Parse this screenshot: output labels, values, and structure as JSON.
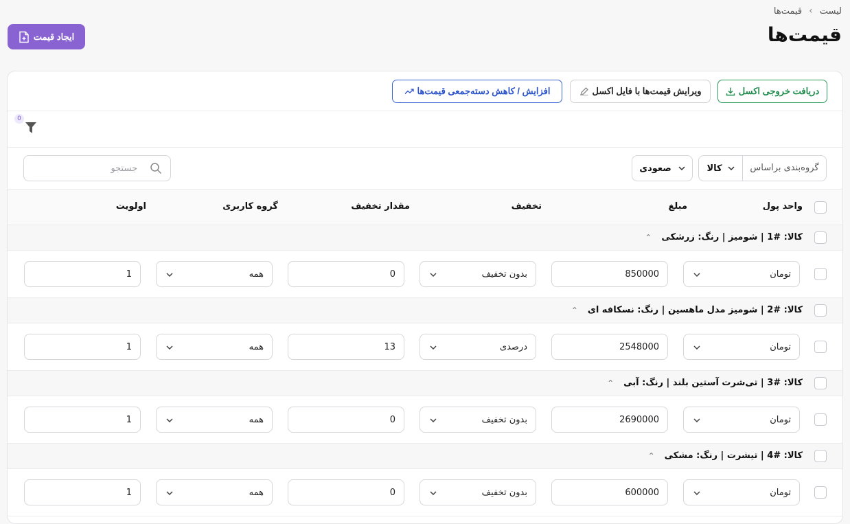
{
  "breadcrumb": {
    "parent": "قیمت‌ها",
    "current": "لیست"
  },
  "page": {
    "title": "قیمت‌ها",
    "create_label": "ایجاد قیمت"
  },
  "toolbar": {
    "export_label": "دریافت خروجی اکسل",
    "edit_excel_label": "ویرایش قیمت‌ها با فایل اکسل",
    "bulk_label": "افزایش / کاهش دسته‌جمعی قیمت‌ها"
  },
  "filter": {
    "count": "0"
  },
  "controls": {
    "group_by_label": "گروه‌بندی براساس",
    "group_by_value": "کالا",
    "sort_value": "صعودی",
    "search_placeholder": "جستجو"
  },
  "columns": {
    "currency": "واحد پول",
    "amount": "مبلغ",
    "discount": "تخفیف",
    "discount_amount": "مقدار تخفیف",
    "user_group": "گروه کاربری",
    "priority": "اولویت"
  },
  "groups": [
    {
      "title": "کالا: #1 | شومیز | رنگ: زرشکی",
      "currency": "تومان",
      "amount": "850000",
      "discount": "بدون تخفیف",
      "discount_amount": "0",
      "user_group": "همه",
      "priority": "1"
    },
    {
      "title": "کالا: #2 | شومیز مدل ماهسین | رنگ: نسکافه ای",
      "currency": "تومان",
      "amount": "2548000",
      "discount": "درصدی",
      "discount_amount": "13",
      "user_group": "همه",
      "priority": "1"
    },
    {
      "title": "کالا: #3 | تی‌شرت آستین بلند | رنگ: آبی",
      "currency": "تومان",
      "amount": "2690000",
      "discount": "بدون تخفیف",
      "discount_amount": "0",
      "user_group": "همه",
      "priority": "1"
    },
    {
      "title": "کالا: #4 | تیشرت | رنگ: مشکی",
      "currency": "تومان",
      "amount": "600000",
      "discount": "بدون تخفیف",
      "discount_amount": "0",
      "user_group": "همه",
      "priority": "1"
    }
  ],
  "icons": {
    "create": "file-plus-icon",
    "export": "download-icon",
    "edit": "pencil-icon",
    "bulk": "trend-up-icon",
    "filter": "funnel-icon",
    "search": "search-icon",
    "chevron": "chevron-down-icon",
    "collapse": "chevron-up-icon"
  },
  "colors": {
    "primary": "#8a63d2",
    "export": "#1f8a4c",
    "bulk": "#2a52c8"
  }
}
